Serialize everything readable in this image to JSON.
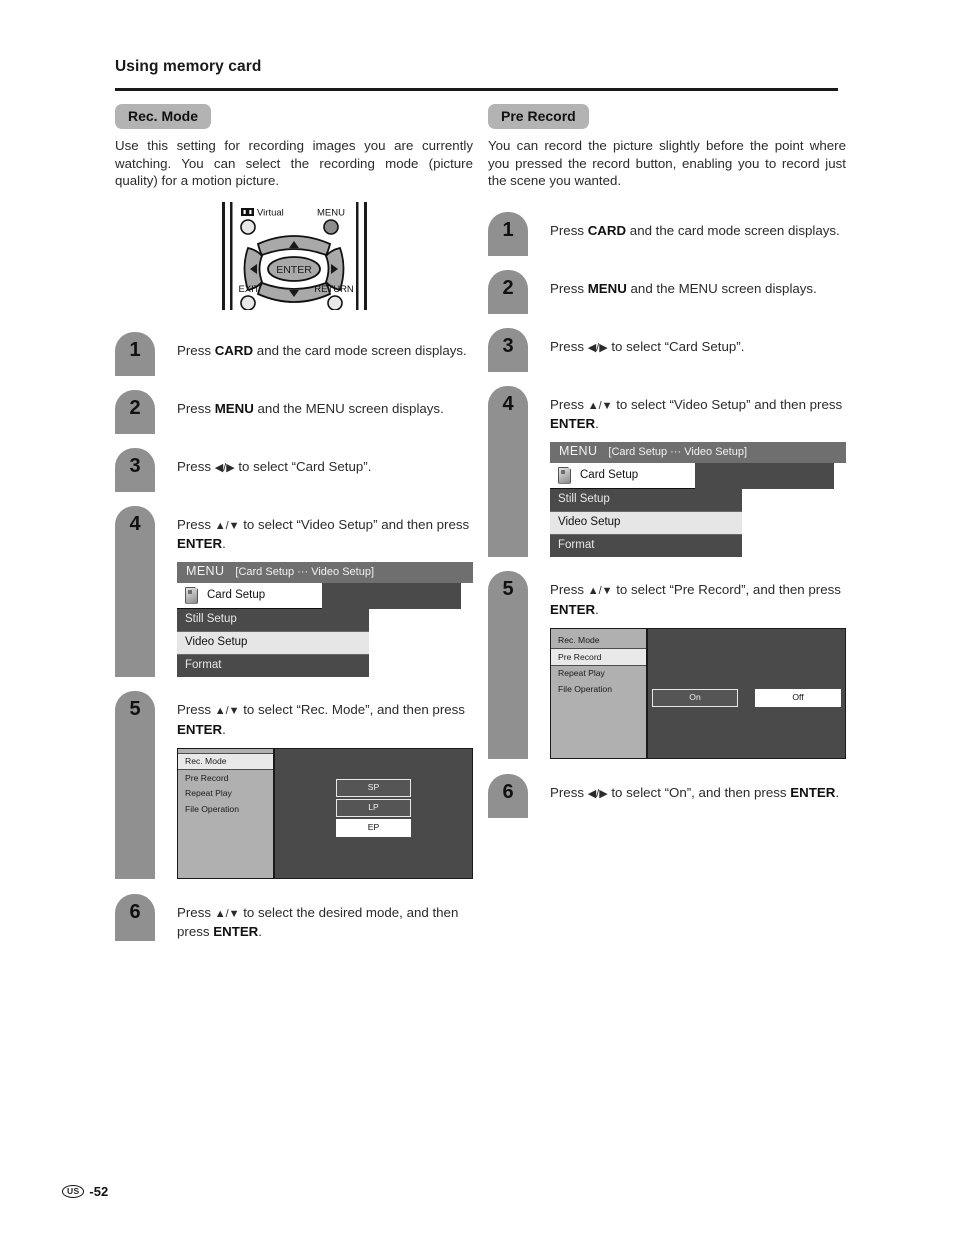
{
  "header": {
    "title": "Using memory card"
  },
  "footer": {
    "region": "US",
    "page": "-52"
  },
  "remote": {
    "labels": {
      "virtual": "Virtual",
      "menu": "MENU",
      "enter": "ENTER",
      "exit": "EXIT",
      "return": "RETURN"
    }
  },
  "osd_menu_screen": {
    "title": "MENU",
    "path": "[Card Setup ··· Video Setup]",
    "tab_label": "Card Setup",
    "items": [
      {
        "label": "Still Setup",
        "selected": false
      },
      {
        "label": "Video Setup",
        "selected": true
      },
      {
        "label": "Format",
        "selected": false
      }
    ]
  },
  "left": {
    "heading": "Rec. Mode",
    "intro": "Use this setting for recording images you are currently watching. You can select the recording mode (picture quality) for a motion picture.",
    "steps": [
      {
        "num": "1",
        "html": "Press <b>CARD</b> and the card mode screen displays."
      },
      {
        "num": "2",
        "html": "Press <b>MENU</b> and the MENU screen displays."
      },
      {
        "num": "3",
        "html": "Press <span class=\"arr\">◀/▶</span> to select “Card Setup”."
      },
      {
        "num": "4",
        "html": "Press <span class=\"arr\">▲/▼</span> to select “Video Setup” and then press <b>ENTER</b>."
      },
      {
        "num": "5",
        "html": "Press <span class=\"arr\">▲/▼</span> to select “Rec. Mode”, and then press <b>ENTER</b>."
      },
      {
        "num": "6",
        "html": "Press <span class=\"arr\">▲/▼</span> to select the desired mode, and then press <b>ENTER</b>."
      }
    ],
    "submenu": {
      "items": [
        {
          "label": "Rec. Mode",
          "selected": true
        },
        {
          "label": "Pre Record",
          "selected": false
        },
        {
          "label": "Repeat Play",
          "selected": false
        },
        {
          "label": "File Operation",
          "selected": false
        }
      ],
      "options": [
        {
          "label": "SP",
          "selected": false
        },
        {
          "label": "LP",
          "selected": false
        },
        {
          "label": "EP",
          "selected": true
        }
      ]
    }
  },
  "right": {
    "heading": "Pre Record",
    "intro": "You can record the picture slightly before the point where you pressed the record button, enabling you to record just the scene you wanted.",
    "steps": [
      {
        "num": "1",
        "html": "Press <b>CARD</b> and the card mode screen displays."
      },
      {
        "num": "2",
        "html": "Press <b>MENU</b> and the MENU screen displays."
      },
      {
        "num": "3",
        "html": "Press <span class=\"arr\">◀/▶</span> to select “Card Setup”."
      },
      {
        "num": "4",
        "html": "Press <span class=\"arr\">▲/▼</span> to select “Video Setup” and then press <b>ENTER</b>."
      },
      {
        "num": "5",
        "html": "Press <span class=\"arr\">▲/▼</span> to select “Pre Record”, and then press <b>ENTER</b>."
      },
      {
        "num": "6",
        "html": "Press <span class=\"arr\">◀/▶</span> to select “On”, and then press <b>ENTER</b>."
      }
    ],
    "submenu": {
      "items": [
        {
          "label": "Rec. Mode",
          "selected": false
        },
        {
          "label": "Pre Record",
          "selected": true
        },
        {
          "label": "Repeat Play",
          "selected": false
        },
        {
          "label": "File Operation",
          "selected": false
        }
      ],
      "options": [
        {
          "label": "On",
          "selected": false
        },
        {
          "label": "Off",
          "selected": true
        }
      ]
    }
  }
}
